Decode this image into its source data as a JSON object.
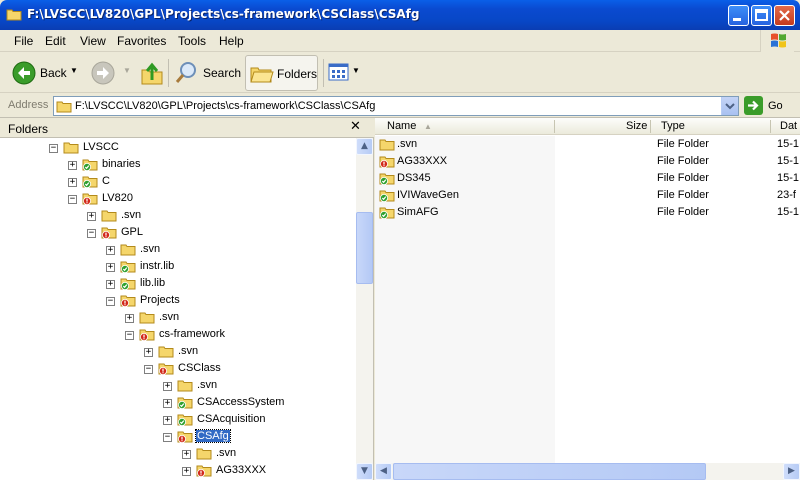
{
  "window": {
    "title": "F:\\LVSCC\\LV820\\GPL\\Projects\\cs-framework\\CSClass\\CSAfg"
  },
  "menu": [
    "File",
    "Edit",
    "View",
    "Favorites",
    "Tools",
    "Help"
  ],
  "toolbar": {
    "back_label": "Back",
    "search_label": "Search",
    "folders_label": "Folders"
  },
  "address": {
    "label": "Address",
    "value": "F:\\LVSCC\\LV820\\GPL\\Projects\\cs-framework\\CSClass\\CSAfg",
    "go_label": "Go"
  },
  "folders_pane": {
    "title": "Folders",
    "close_glyph": "✕",
    "tree": [
      {
        "label": "LVSCC",
        "expander": "−",
        "icon": "folder-yellow"
      },
      {
        "label": "binaries",
        "expander": "+",
        "icon": "folder-green"
      },
      {
        "label": "C",
        "expander": "+",
        "icon": "folder-green"
      },
      {
        "label": "LV820",
        "expander": "−",
        "icon": "folder-red"
      },
      {
        "label": ".svn",
        "expander": "+",
        "icon": "folder-yellow"
      },
      {
        "label": "GPL",
        "expander": "−",
        "icon": "folder-red"
      },
      {
        "label": ".svn",
        "expander": "+",
        "icon": "folder-yellow"
      },
      {
        "label": "instr.lib",
        "expander": "+",
        "icon": "folder-green"
      },
      {
        "label": "lib.lib",
        "expander": "+",
        "icon": "folder-green"
      },
      {
        "label": "Projects",
        "expander": "−",
        "icon": "folder-red"
      },
      {
        "label": ".svn",
        "expander": "+",
        "icon": "folder-yellow"
      },
      {
        "label": "cs-framework",
        "expander": "−",
        "icon": "folder-red"
      },
      {
        "label": ".svn",
        "expander": "+",
        "icon": "folder-yellow"
      },
      {
        "label": "CSClass",
        "expander": "−",
        "icon": "folder-red"
      },
      {
        "label": ".svn",
        "expander": "+",
        "icon": "folder-yellow"
      },
      {
        "label": "CSAccessSystem",
        "expander": "+",
        "icon": "folder-green"
      },
      {
        "label": "CSAcquisition",
        "expander": "+",
        "icon": "folder-green"
      },
      {
        "label": "CSAfg",
        "expander": "−",
        "icon": "folder-red",
        "selected": true
      },
      {
        "label": ".svn",
        "expander": "+",
        "icon": "folder-yellow"
      },
      {
        "label": "AG33XXX",
        "expander": "+",
        "icon": "folder-red"
      }
    ]
  },
  "file_list": {
    "columns": [
      "Name",
      "Size",
      "Type",
      "Dat"
    ],
    "sort_indicator": "▲",
    "rows": [
      {
        "name": ".svn",
        "size": "",
        "type": "File Folder",
        "date": "15-1",
        "icon": "folder-yellow"
      },
      {
        "name": "AG33XXX",
        "size": "",
        "type": "File Folder",
        "date": "15-1",
        "icon": "folder-red"
      },
      {
        "name": "DS345",
        "size": "",
        "type": "File Folder",
        "date": "15-1",
        "icon": "folder-green"
      },
      {
        "name": "IVIWaveGen",
        "size": "",
        "type": "File Folder",
        "date": "23-f",
        "icon": "folder-green"
      },
      {
        "name": "SimAFG",
        "size": "",
        "type": "File Folder",
        "date": "15-1",
        "icon": "folder-green"
      }
    ]
  },
  "colors": {
    "titlebar": "#0a4ad0",
    "selection": "#316ac5",
    "folder_yellow": "#f5d66b",
    "badge_green": "#2fa02f",
    "badge_red": "#d22a1a"
  }
}
